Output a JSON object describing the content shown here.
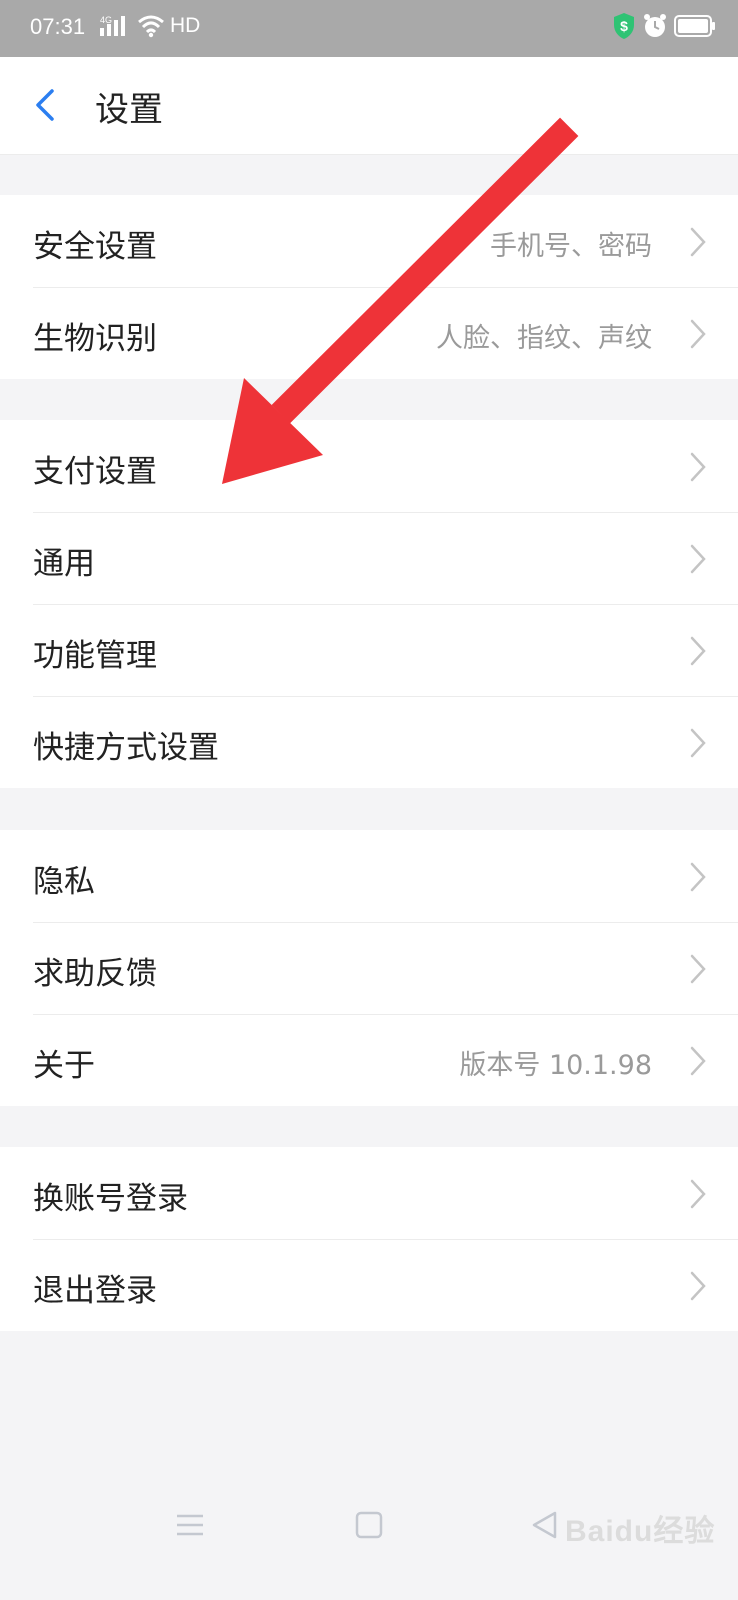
{
  "status_bar": {
    "time": "07:31",
    "network": "4G",
    "hd": "HD"
  },
  "header": {
    "title": "设置"
  },
  "groups": [
    {
      "items": [
        {
          "label": "安全设置",
          "value": "手机号、密码"
        },
        {
          "label": "生物识别",
          "value": "人脸、指纹、声纹"
        }
      ]
    },
    {
      "items": [
        {
          "label": "支付设置",
          "value": ""
        },
        {
          "label": "通用",
          "value": ""
        },
        {
          "label": "功能管理",
          "value": ""
        },
        {
          "label": "快捷方式设置",
          "value": ""
        }
      ]
    },
    {
      "items": [
        {
          "label": "隐私",
          "value": ""
        },
        {
          "label": "求助反馈",
          "value": ""
        },
        {
          "label": "关于",
          "value": "版本号 10.1.98"
        }
      ]
    },
    {
      "items": [
        {
          "label": "换账号登录",
          "value": ""
        },
        {
          "label": "退出登录",
          "value": ""
        }
      ]
    }
  ],
  "watermark": "Baidu经验",
  "colors": {
    "accent": "#2b7ef0",
    "arrow": "#ee3338",
    "shield": "#2fc374"
  },
  "icons": [
    "back-chevron-icon",
    "chevron-right-icon",
    "shield-icon",
    "alarm-icon",
    "battery-icon",
    "wifi-icon",
    "signal-icon",
    "menu-icon",
    "home-icon",
    "back-triangle-icon"
  ]
}
